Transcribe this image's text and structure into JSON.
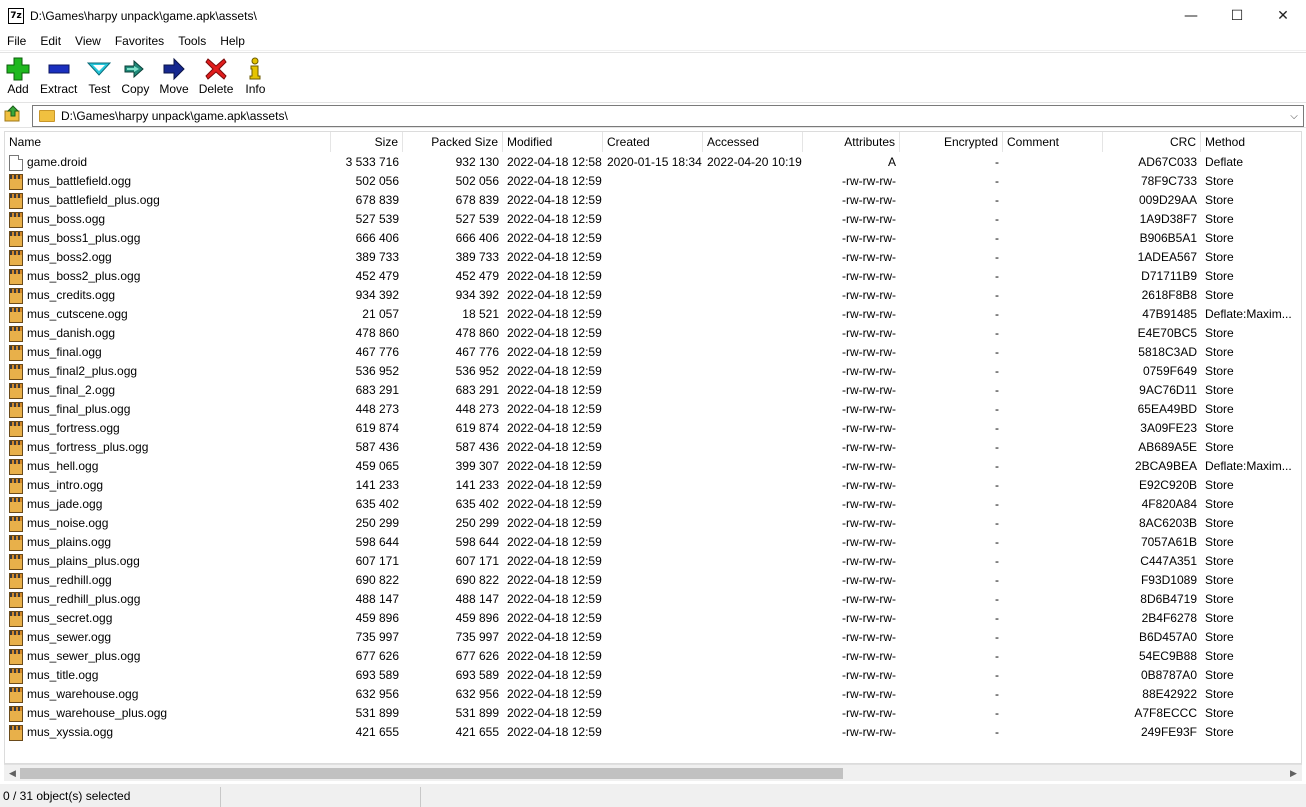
{
  "window": {
    "title": "D:\\Games\\harpy unpack\\game.apk\\assets\\",
    "app_icon_text": "7z",
    "minimize": "—",
    "maximize": "☐",
    "close": "✕"
  },
  "menu": [
    "File",
    "Edit",
    "View",
    "Favorites",
    "Tools",
    "Help"
  ],
  "toolbar": {
    "add": "Add",
    "extract": "Extract",
    "test": "Test",
    "copy": "Copy",
    "move": "Move",
    "delete": "Delete",
    "info": "Info"
  },
  "address": {
    "path": "D:\\Games\\harpy unpack\\game.apk\\assets\\"
  },
  "columns": {
    "name": "Name",
    "size": "Size",
    "packed": "Packed Size",
    "modified": "Modified",
    "created": "Created",
    "accessed": "Accessed",
    "attributes": "Attributes",
    "encrypted": "Encrypted",
    "comment": "Comment",
    "crc": "CRC",
    "method": "Method"
  },
  "files": [
    {
      "icon": "document-icon",
      "name": "game.droid",
      "size": "3 533 716",
      "packed": "932 130",
      "modified": "2022-04-18 12:58",
      "created": "2020-01-15 18:34",
      "accessed": "2022-04-20 10:19",
      "attributes": "A",
      "encrypted": "-",
      "comment": "",
      "crc": "AD67C033",
      "method": "Deflate"
    },
    {
      "icon": "media-file-icon",
      "name": "mus_battlefield.ogg",
      "size": "502 056",
      "packed": "502 056",
      "modified": "2022-04-18 12:59",
      "created": "",
      "accessed": "",
      "attributes": "-rw-rw-rw-",
      "encrypted": "-",
      "comment": "",
      "crc": "78F9C733",
      "method": "Store"
    },
    {
      "icon": "media-file-icon",
      "name": "mus_battlefield_plus.ogg",
      "size": "678 839",
      "packed": "678 839",
      "modified": "2022-04-18 12:59",
      "created": "",
      "accessed": "",
      "attributes": "-rw-rw-rw-",
      "encrypted": "-",
      "comment": "",
      "crc": "009D29AA",
      "method": "Store"
    },
    {
      "icon": "media-file-icon",
      "name": "mus_boss.ogg",
      "size": "527 539",
      "packed": "527 539",
      "modified": "2022-04-18 12:59",
      "created": "",
      "accessed": "",
      "attributes": "-rw-rw-rw-",
      "encrypted": "-",
      "comment": "",
      "crc": "1A9D38F7",
      "method": "Store"
    },
    {
      "icon": "media-file-icon",
      "name": "mus_boss1_plus.ogg",
      "size": "666 406",
      "packed": "666 406",
      "modified": "2022-04-18 12:59",
      "created": "",
      "accessed": "",
      "attributes": "-rw-rw-rw-",
      "encrypted": "-",
      "comment": "",
      "crc": "B906B5A1",
      "method": "Store"
    },
    {
      "icon": "media-file-icon",
      "name": "mus_boss2.ogg",
      "size": "389 733",
      "packed": "389 733",
      "modified": "2022-04-18 12:59",
      "created": "",
      "accessed": "",
      "attributes": "-rw-rw-rw-",
      "encrypted": "-",
      "comment": "",
      "crc": "1ADEA567",
      "method": "Store"
    },
    {
      "icon": "media-file-icon",
      "name": "mus_boss2_plus.ogg",
      "size": "452 479",
      "packed": "452 479",
      "modified": "2022-04-18 12:59",
      "created": "",
      "accessed": "",
      "attributes": "-rw-rw-rw-",
      "encrypted": "-",
      "comment": "",
      "crc": "D71711B9",
      "method": "Store"
    },
    {
      "icon": "media-file-icon",
      "name": "mus_credits.ogg",
      "size": "934 392",
      "packed": "934 392",
      "modified": "2022-04-18 12:59",
      "created": "",
      "accessed": "",
      "attributes": "-rw-rw-rw-",
      "encrypted": "-",
      "comment": "",
      "crc": "2618F8B8",
      "method": "Store"
    },
    {
      "icon": "media-file-icon",
      "name": "mus_cutscene.ogg",
      "size": "21 057",
      "packed": "18 521",
      "modified": "2022-04-18 12:59",
      "created": "",
      "accessed": "",
      "attributes": "-rw-rw-rw-",
      "encrypted": "-",
      "comment": "",
      "crc": "47B91485",
      "method": "Deflate:Maxim..."
    },
    {
      "icon": "media-file-icon",
      "name": "mus_danish.ogg",
      "size": "478 860",
      "packed": "478 860",
      "modified": "2022-04-18 12:59",
      "created": "",
      "accessed": "",
      "attributes": "-rw-rw-rw-",
      "encrypted": "-",
      "comment": "",
      "crc": "E4E70BC5",
      "method": "Store"
    },
    {
      "icon": "media-file-icon",
      "name": "mus_final.ogg",
      "size": "467 776",
      "packed": "467 776",
      "modified": "2022-04-18 12:59",
      "created": "",
      "accessed": "",
      "attributes": "-rw-rw-rw-",
      "encrypted": "-",
      "comment": "",
      "crc": "5818C3AD",
      "method": "Store"
    },
    {
      "icon": "media-file-icon",
      "name": "mus_final2_plus.ogg",
      "size": "536 952",
      "packed": "536 952",
      "modified": "2022-04-18 12:59",
      "created": "",
      "accessed": "",
      "attributes": "-rw-rw-rw-",
      "encrypted": "-",
      "comment": "",
      "crc": "0759F649",
      "method": "Store"
    },
    {
      "icon": "media-file-icon",
      "name": "mus_final_2.ogg",
      "size": "683 291",
      "packed": "683 291",
      "modified": "2022-04-18 12:59",
      "created": "",
      "accessed": "",
      "attributes": "-rw-rw-rw-",
      "encrypted": "-",
      "comment": "",
      "crc": "9AC76D11",
      "method": "Store"
    },
    {
      "icon": "media-file-icon",
      "name": "mus_final_plus.ogg",
      "size": "448 273",
      "packed": "448 273",
      "modified": "2022-04-18 12:59",
      "created": "",
      "accessed": "",
      "attributes": "-rw-rw-rw-",
      "encrypted": "-",
      "comment": "",
      "crc": "65EA49BD",
      "method": "Store"
    },
    {
      "icon": "media-file-icon",
      "name": "mus_fortress.ogg",
      "size": "619 874",
      "packed": "619 874",
      "modified": "2022-04-18 12:59",
      "created": "",
      "accessed": "",
      "attributes": "-rw-rw-rw-",
      "encrypted": "-",
      "comment": "",
      "crc": "3A09FE23",
      "method": "Store"
    },
    {
      "icon": "media-file-icon",
      "name": "mus_fortress_plus.ogg",
      "size": "587 436",
      "packed": "587 436",
      "modified": "2022-04-18 12:59",
      "created": "",
      "accessed": "",
      "attributes": "-rw-rw-rw-",
      "encrypted": "-",
      "comment": "",
      "crc": "AB689A5E",
      "method": "Store"
    },
    {
      "icon": "media-file-icon",
      "name": "mus_hell.ogg",
      "size": "459 065",
      "packed": "399 307",
      "modified": "2022-04-18 12:59",
      "created": "",
      "accessed": "",
      "attributes": "-rw-rw-rw-",
      "encrypted": "-",
      "comment": "",
      "crc": "2BCA9BEA",
      "method": "Deflate:Maxim..."
    },
    {
      "icon": "media-file-icon",
      "name": "mus_intro.ogg",
      "size": "141 233",
      "packed": "141 233",
      "modified": "2022-04-18 12:59",
      "created": "",
      "accessed": "",
      "attributes": "-rw-rw-rw-",
      "encrypted": "-",
      "comment": "",
      "crc": "E92C920B",
      "method": "Store"
    },
    {
      "icon": "media-file-icon",
      "name": "mus_jade.ogg",
      "size": "635 402",
      "packed": "635 402",
      "modified": "2022-04-18 12:59",
      "created": "",
      "accessed": "",
      "attributes": "-rw-rw-rw-",
      "encrypted": "-",
      "comment": "",
      "crc": "4F820A84",
      "method": "Store"
    },
    {
      "icon": "media-file-icon",
      "name": "mus_noise.ogg",
      "size": "250 299",
      "packed": "250 299",
      "modified": "2022-04-18 12:59",
      "created": "",
      "accessed": "",
      "attributes": "-rw-rw-rw-",
      "encrypted": "-",
      "comment": "",
      "crc": "8AC6203B",
      "method": "Store"
    },
    {
      "icon": "media-file-icon",
      "name": "mus_plains.ogg",
      "size": "598 644",
      "packed": "598 644",
      "modified": "2022-04-18 12:59",
      "created": "",
      "accessed": "",
      "attributes": "-rw-rw-rw-",
      "encrypted": "-",
      "comment": "",
      "crc": "7057A61B",
      "method": "Store"
    },
    {
      "icon": "media-file-icon",
      "name": "mus_plains_plus.ogg",
      "size": "607 171",
      "packed": "607 171",
      "modified": "2022-04-18 12:59",
      "created": "",
      "accessed": "",
      "attributes": "-rw-rw-rw-",
      "encrypted": "-",
      "comment": "",
      "crc": "C447A351",
      "method": "Store"
    },
    {
      "icon": "media-file-icon",
      "name": "mus_redhill.ogg",
      "size": "690 822",
      "packed": "690 822",
      "modified": "2022-04-18 12:59",
      "created": "",
      "accessed": "",
      "attributes": "-rw-rw-rw-",
      "encrypted": "-",
      "comment": "",
      "crc": "F93D1089",
      "method": "Store"
    },
    {
      "icon": "media-file-icon",
      "name": "mus_redhill_plus.ogg",
      "size": "488 147",
      "packed": "488 147",
      "modified": "2022-04-18 12:59",
      "created": "",
      "accessed": "",
      "attributes": "-rw-rw-rw-",
      "encrypted": "-",
      "comment": "",
      "crc": "8D6B4719",
      "method": "Store"
    },
    {
      "icon": "media-file-icon",
      "name": "mus_secret.ogg",
      "size": "459 896",
      "packed": "459 896",
      "modified": "2022-04-18 12:59",
      "created": "",
      "accessed": "",
      "attributes": "-rw-rw-rw-",
      "encrypted": "-",
      "comment": "",
      "crc": "2B4F6278",
      "method": "Store"
    },
    {
      "icon": "media-file-icon",
      "name": "mus_sewer.ogg",
      "size": "735 997",
      "packed": "735 997",
      "modified": "2022-04-18 12:59",
      "created": "",
      "accessed": "",
      "attributes": "-rw-rw-rw-",
      "encrypted": "-",
      "comment": "",
      "crc": "B6D457A0",
      "method": "Store"
    },
    {
      "icon": "media-file-icon",
      "name": "mus_sewer_plus.ogg",
      "size": "677 626",
      "packed": "677 626",
      "modified": "2022-04-18 12:59",
      "created": "",
      "accessed": "",
      "attributes": "-rw-rw-rw-",
      "encrypted": "-",
      "comment": "",
      "crc": "54EC9B88",
      "method": "Store"
    },
    {
      "icon": "media-file-icon",
      "name": "mus_title.ogg",
      "size": "693 589",
      "packed": "693 589",
      "modified": "2022-04-18 12:59",
      "created": "",
      "accessed": "",
      "attributes": "-rw-rw-rw-",
      "encrypted": "-",
      "comment": "",
      "crc": "0B8787A0",
      "method": "Store"
    },
    {
      "icon": "media-file-icon",
      "name": "mus_warehouse.ogg",
      "size": "632 956",
      "packed": "632 956",
      "modified": "2022-04-18 12:59",
      "created": "",
      "accessed": "",
      "attributes": "-rw-rw-rw-",
      "encrypted": "-",
      "comment": "",
      "crc": "88E42922",
      "method": "Store"
    },
    {
      "icon": "media-file-icon",
      "name": "mus_warehouse_plus.ogg",
      "size": "531 899",
      "packed": "531 899",
      "modified": "2022-04-18 12:59",
      "created": "",
      "accessed": "",
      "attributes": "-rw-rw-rw-",
      "encrypted": "-",
      "comment": "",
      "crc": "A7F8ECCC",
      "method": "Store"
    },
    {
      "icon": "media-file-icon",
      "name": "mus_xyssia.ogg",
      "size": "421 655",
      "packed": "421 655",
      "modified": "2022-04-18 12:59",
      "created": "",
      "accessed": "",
      "attributes": "-rw-rw-rw-",
      "encrypted": "-",
      "comment": "",
      "crc": "249FE93F",
      "method": "Store"
    }
  ],
  "status": {
    "selection": "0 / 31 object(s) selected"
  },
  "colors": {
    "add": "#1fb81f",
    "extract": "#1a2fbf",
    "test": "#26c6da",
    "copy": "#1f8a7a",
    "move": "#16288f",
    "delete": "#e11d1d",
    "info": "#e5c400"
  }
}
